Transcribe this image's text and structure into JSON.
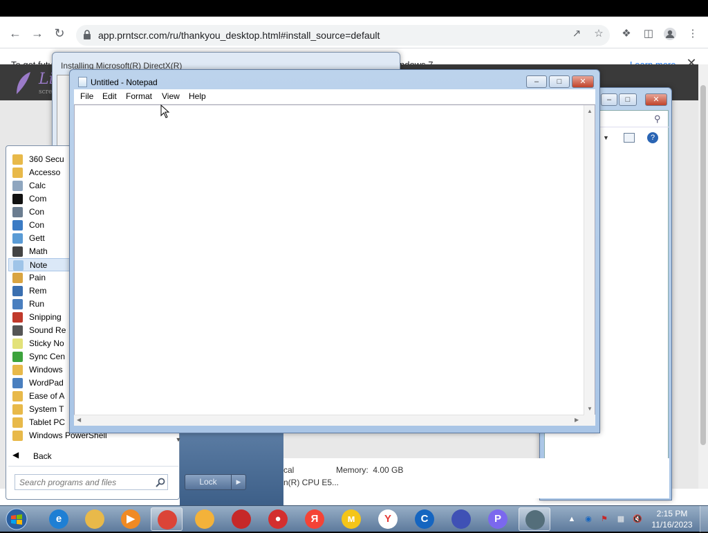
{
  "browser": {
    "url": "app.prntscr.com/ru/thankyou_desktop.html#install_source=default",
    "infobar_text_start": "To get futu",
    "infobar_text_end": "ndows 7.",
    "learn_more": "Learn more"
  },
  "page": {
    "logo_text": "Li",
    "logo_sub": "scre"
  },
  "directx": {
    "title": "Installing Microsoft(R) DirectX(R)"
  },
  "sysinfo": {
    "row1_left": "cal",
    "memory_label": "Memory:",
    "memory_value": "4.00 GB",
    "row2_left": "n(R) CPU E5..."
  },
  "start_menu": {
    "items": [
      {
        "label": "360 Secu",
        "icon": "folder-icon",
        "color": "#e8b94a",
        "selected": false
      },
      {
        "label": "Accesso",
        "icon": "folder-icon",
        "color": "#e8b94a",
        "selected": false
      },
      {
        "label": "Calc",
        "icon": "calculator-icon",
        "color": "#8fa6bf",
        "selected": false
      },
      {
        "label": "Com",
        "icon": "command-prompt-icon",
        "color": "#111111",
        "selected": false
      },
      {
        "label": "Con",
        "icon": "connect-projector-icon",
        "color": "#6b7d90",
        "selected": false
      },
      {
        "label": "Con",
        "icon": "remote-connection-icon",
        "color": "#3b7bc4",
        "selected": false
      },
      {
        "label": "Gett",
        "icon": "getting-started-icon",
        "color": "#5a9bd5",
        "selected": false
      },
      {
        "label": "Math",
        "icon": "math-input-icon",
        "color": "#444444",
        "selected": false
      },
      {
        "label": "Note",
        "icon": "notepad-icon",
        "color": "#9fc4e8",
        "selected": true
      },
      {
        "label": "Pain",
        "icon": "paint-icon",
        "color": "#d9a441",
        "selected": false
      },
      {
        "label": "Rem",
        "icon": "remote-desktop-icon",
        "color": "#3a6fb0",
        "selected": false
      },
      {
        "label": "Run",
        "icon": "run-icon",
        "color": "#4a7fbf",
        "selected": false
      },
      {
        "label": "Snipping",
        "icon": "snipping-tool-icon",
        "color": "#c0392b",
        "selected": false
      },
      {
        "label": "Sound Re",
        "icon": "microphone-icon",
        "color": "#555555",
        "selected": false
      },
      {
        "label": "Sticky No",
        "icon": "sticky-notes-icon",
        "color": "#e3e27a",
        "selected": false
      },
      {
        "label": "Sync Cen",
        "icon": "sync-center-icon",
        "color": "#3da33d",
        "selected": false
      },
      {
        "label": "Windows",
        "icon": "windows-explorer-icon",
        "color": "#e8b94a",
        "selected": false
      },
      {
        "label": "WordPad",
        "icon": "wordpad-icon",
        "color": "#4a7fbf",
        "selected": false
      },
      {
        "label": "Ease of A",
        "icon": "folder-icon",
        "color": "#e8b94a",
        "selected": false
      },
      {
        "label": "System T",
        "icon": "folder-icon",
        "color": "#e8b94a",
        "selected": false
      },
      {
        "label": "Tablet PC",
        "icon": "folder-icon",
        "color": "#e8b94a",
        "selected": false
      },
      {
        "label": "Windows PowerShell",
        "icon": "folder-icon",
        "color": "#e8b94a",
        "selected": false
      }
    ],
    "back": "Back",
    "search_placeholder": "Search programs and files",
    "lock": "Lock"
  },
  "notepad": {
    "title": "Untitled - Notepad",
    "menu": [
      "File",
      "Edit",
      "Format",
      "View",
      "Help"
    ],
    "content": ""
  },
  "taskbar": {
    "apps": [
      {
        "name": "internet-explorer",
        "glyph": "e",
        "color": "#1e7fd4",
        "active": false
      },
      {
        "name": "windows-explorer",
        "glyph": "",
        "color": "#e8b94a",
        "active": false
      },
      {
        "name": "media-player",
        "glyph": "▶",
        "color": "#f08a24",
        "active": false
      },
      {
        "name": "chrome",
        "glyph": "",
        "color": "#db4437",
        "active": true
      },
      {
        "name": "browser-shield",
        "glyph": "",
        "color": "#f3b23a",
        "active": false
      },
      {
        "name": "antivirus",
        "glyph": "",
        "color": "#c62828",
        "active": false
      },
      {
        "name": "screen-recorder",
        "glyph": "●",
        "color": "#d32f2f",
        "active": false
      },
      {
        "name": "yandex",
        "glyph": "Я",
        "color": "#f44336",
        "active": false
      },
      {
        "name": "yandex-music",
        "glyph": "м",
        "color": "#f5c518",
        "active": false
      },
      {
        "name": "yandex-browser",
        "glyph": "Y",
        "color": "#ffffff",
        "active": false
      },
      {
        "name": "ccleaner",
        "glyph": "C",
        "color": "#1565c0",
        "active": false
      },
      {
        "name": "screenshot-editor",
        "glyph": "",
        "color": "#3f51b5",
        "active": false
      },
      {
        "name": "lightshot",
        "glyph": "P",
        "color": "#7b68ee",
        "active": false
      },
      {
        "name": "network-monitor",
        "glyph": "",
        "color": "#546e7a",
        "active": true
      }
    ],
    "time": "2:15 PM",
    "date": "11/16/2023"
  }
}
